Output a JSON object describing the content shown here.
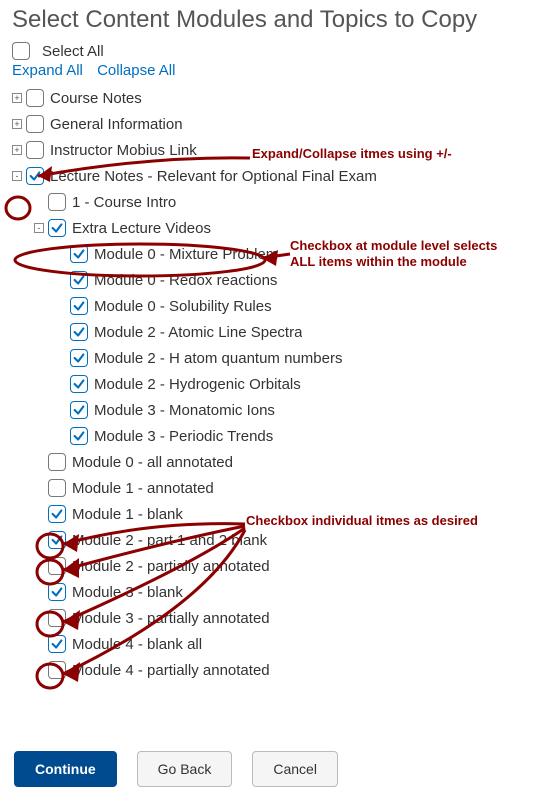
{
  "page_title": "Select Content Modules and Topics to Copy",
  "select_all_label": "Select All",
  "expand_label": "Expand All",
  "collapse_label": "Collapse All",
  "tree": [
    {
      "level": 0,
      "toggler": "+",
      "checked": false,
      "label": "Course Notes"
    },
    {
      "level": 0,
      "toggler": "+",
      "checked": false,
      "label": "General Information"
    },
    {
      "level": 0,
      "toggler": "+",
      "checked": false,
      "label": "Instructor Mobius Link"
    },
    {
      "level": 0,
      "toggler": "-",
      "checked": true,
      "label": "Lecture Notes - Relevant for Optional Final Exam"
    },
    {
      "level": 1,
      "toggler": "",
      "checked": false,
      "label": "1 - Course Intro"
    },
    {
      "level": 1,
      "toggler": "-",
      "checked": true,
      "label": "Extra Lecture Videos"
    },
    {
      "level": 2,
      "toggler": "",
      "checked": true,
      "label": "Module 0 - Mixture Problem"
    },
    {
      "level": 2,
      "toggler": "",
      "checked": true,
      "label": "Module 0 - Redox reactions"
    },
    {
      "level": 2,
      "toggler": "",
      "checked": true,
      "label": "Module 0 - Solubility Rules"
    },
    {
      "level": 2,
      "toggler": "",
      "checked": true,
      "label": "Module 2 - Atomic Line Spectra"
    },
    {
      "level": 2,
      "toggler": "",
      "checked": true,
      "label": "Module 2 - H atom quantum numbers"
    },
    {
      "level": 2,
      "toggler": "",
      "checked": true,
      "label": "Module 2 - Hydrogenic Orbitals"
    },
    {
      "level": 2,
      "toggler": "",
      "checked": true,
      "label": "Module 3 - Monatomic Ions"
    },
    {
      "level": 2,
      "toggler": "",
      "checked": true,
      "label": "Module 3 - Periodic Trends"
    },
    {
      "level": 1,
      "toggler": "",
      "checked": false,
      "label": "Module 0 - all annotated"
    },
    {
      "level": 1,
      "toggler": "",
      "checked": false,
      "label": "Module 1 - annotated"
    },
    {
      "level": 1,
      "toggler": "",
      "checked": true,
      "label": "Module 1 - blank"
    },
    {
      "level": 1,
      "toggler": "",
      "checked": true,
      "label": "Module 2 - part 1 and 2 blank"
    },
    {
      "level": 1,
      "toggler": "",
      "checked": false,
      "label": "Module 2 - partially annotated"
    },
    {
      "level": 1,
      "toggler": "",
      "checked": true,
      "label": "Module 3 - blank"
    },
    {
      "level": 1,
      "toggler": "",
      "checked": false,
      "label": "Module 3 - partially annotated"
    },
    {
      "level": 1,
      "toggler": "",
      "checked": true,
      "label": "Module 4 - blank all"
    },
    {
      "level": 1,
      "toggler": "",
      "checked": false,
      "label": "Module 4 - partially annotated"
    }
  ],
  "buttons": {
    "continue": "Continue",
    "goback": "Go Back",
    "cancel": "Cancel"
  },
  "annotations": {
    "expand_hint": "Expand/Collapse itmes using +/-",
    "module_hint_l1": "Checkbox at module level selects",
    "module_hint_l2": "ALL items within the module",
    "individual_hint": "Checkbox individual itmes as desired"
  },
  "colors": {
    "annotation": "#8b0000",
    "primary": "#004a8f",
    "link": "#006fbf"
  }
}
